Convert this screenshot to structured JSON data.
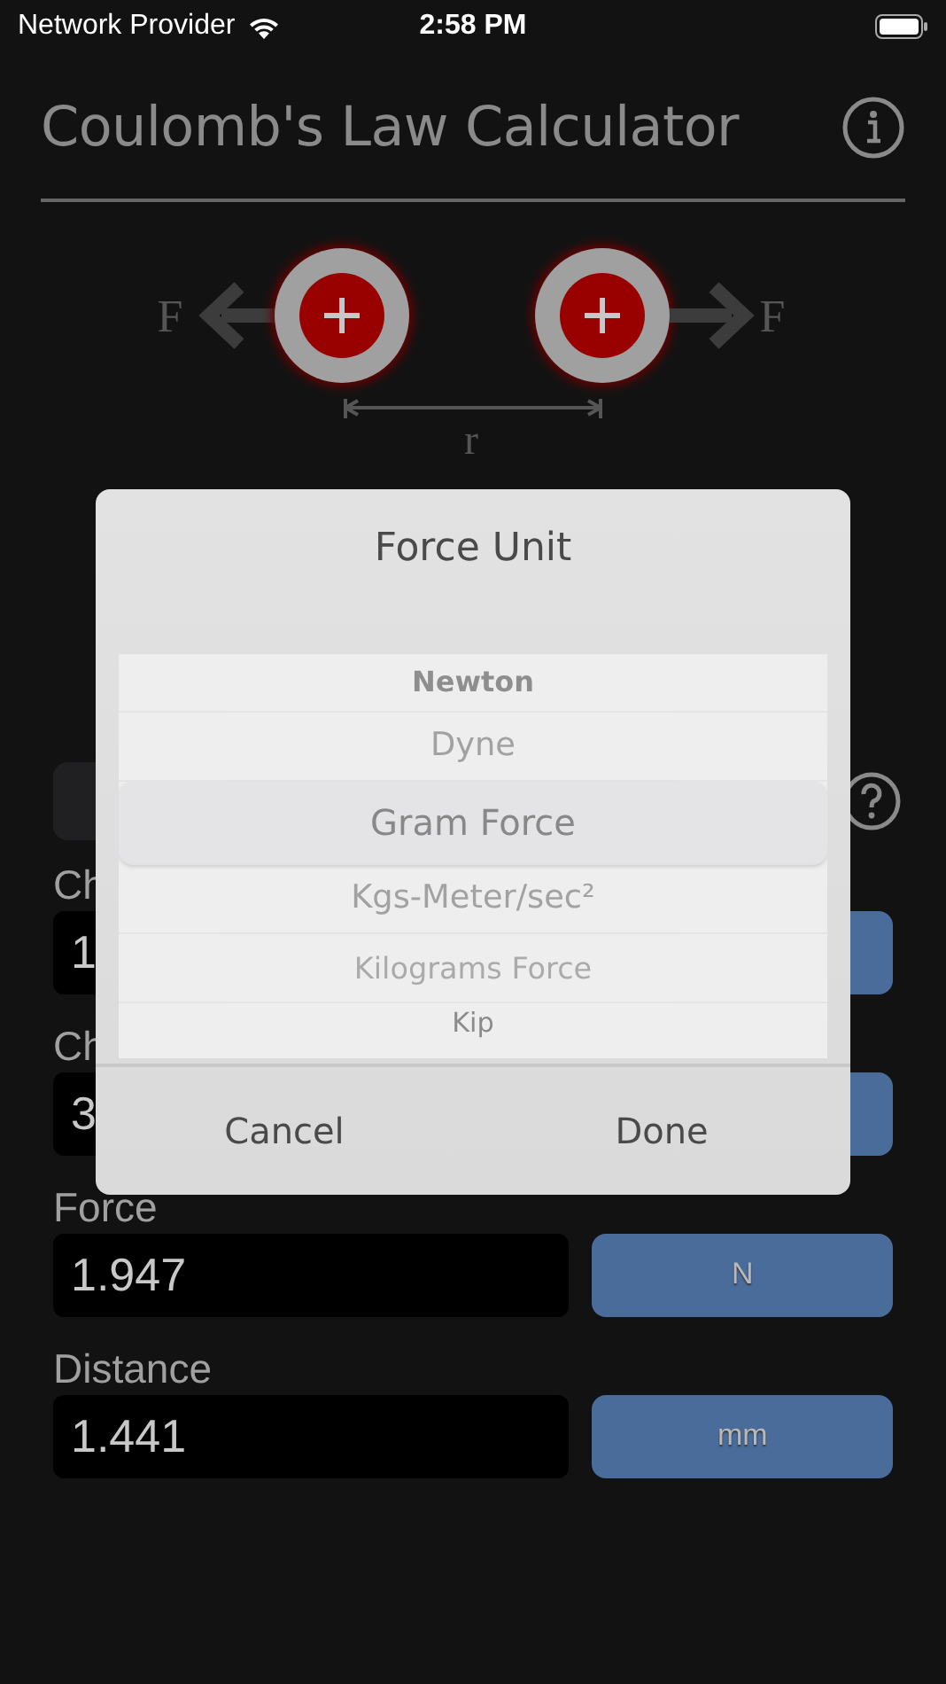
{
  "status_bar": {
    "carrier": "Network Provider",
    "time": "2:58 PM"
  },
  "header": {
    "title": "Coulomb's Law Calculator"
  },
  "diagram": {
    "force_label_left": "F",
    "force_label_right": "F",
    "distance_label": "r"
  },
  "fields": [
    {
      "label": "Ch",
      "value": "1"
    },
    {
      "label": "Ch",
      "value": "3"
    },
    {
      "label": "Force",
      "value": "1.947",
      "unit": "N"
    },
    {
      "label": "Distance",
      "value": "1.441",
      "unit": "mm"
    }
  ],
  "dialog": {
    "title": "Force Unit",
    "options": [
      {
        "label": "Newton",
        "selected": false
      },
      {
        "label": "Dyne",
        "selected": false
      },
      {
        "label": "Gram Force",
        "selected": true
      },
      {
        "label": "Kgs-Meter/sec²",
        "selected": false
      },
      {
        "label": "Kilograms Force",
        "selected": false
      },
      {
        "label": "Kip",
        "selected": false
      }
    ],
    "buttons": [
      "Cancel",
      "Done"
    ]
  }
}
